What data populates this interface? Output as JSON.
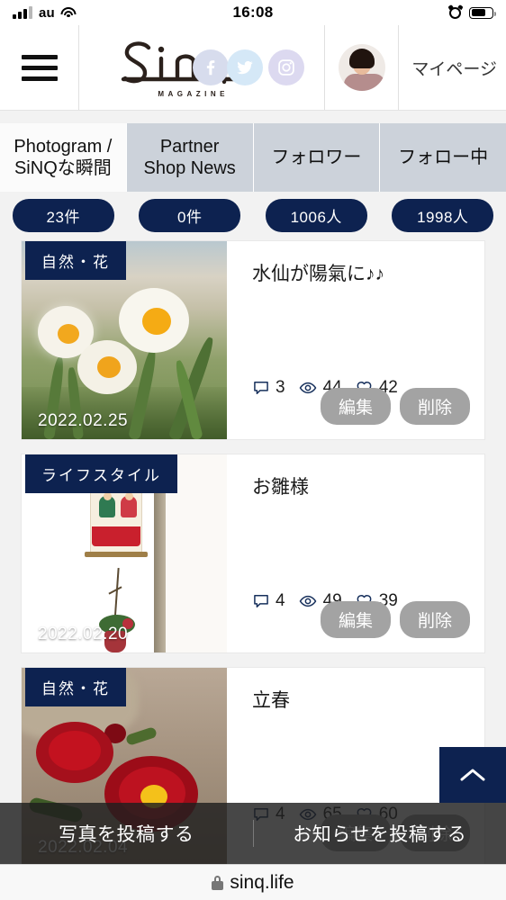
{
  "status_bar": {
    "carrier": "au",
    "time": "16:08",
    "signal_icon": "signal-bars-icon",
    "wifi_icon": "wifi-icon",
    "alarm_icon": "alarm-clock-icon",
    "battery_icon": "battery-icon"
  },
  "header": {
    "menu_icon": "hamburger-menu-icon",
    "logo_text": "SiNQ",
    "logo_subtitle": "MAGAZINE",
    "socials": [
      {
        "name": "facebook-icon",
        "label": "Facebook"
      },
      {
        "name": "twitter-icon",
        "label": "Twitter"
      },
      {
        "name": "instagram-icon",
        "label": "Instagram"
      }
    ],
    "avatar_label": "user-avatar",
    "mypage_label": "マイページ"
  },
  "tabs": [
    {
      "label_line1": "Photogram /",
      "label_line2": "SiNQな瞬間",
      "active": true,
      "count": "23件"
    },
    {
      "label_line1": "Partner",
      "label_line2": "Shop News",
      "active": false,
      "count": "0件"
    },
    {
      "label_line1": "フォロワー",
      "label_line2": "",
      "active": false,
      "count": "1006人"
    },
    {
      "label_line1": "フォロー中",
      "label_line2": "",
      "active": false,
      "count": "1998人"
    }
  ],
  "posts": [
    {
      "category": "自然・花",
      "date": "2022.02.25",
      "title": "水仙が陽氣に♪♪",
      "comments": "3",
      "views": "44",
      "likes": "42",
      "edit_label": "編集",
      "delete_label": "削除"
    },
    {
      "category": "ライフスタイル",
      "date": "2022.02.20",
      "title": "お雛様",
      "comments": "4",
      "views": "49",
      "likes": "39",
      "edit_label": "編集",
      "delete_label": "削除"
    },
    {
      "category": "自然・花",
      "date": "2022.02.04",
      "title": "立春",
      "comments": "4",
      "views": "65",
      "likes": "60",
      "edit_label": "編集",
      "delete_label": "削除"
    }
  ],
  "scroll_top": {
    "icon": "chevron-up-icon"
  },
  "bottom_bar": {
    "post_photo_label": "写真を投稿する",
    "post_news_label": "お知らせを投稿する"
  },
  "browser": {
    "lock_icon": "lock-icon",
    "url": "sinq.life"
  },
  "colors": {
    "navy": "#0d2250",
    "page_bg": "#f2f2f2",
    "tab_inactive": "#ccd2da",
    "button_gray": "#a3a3a3"
  }
}
